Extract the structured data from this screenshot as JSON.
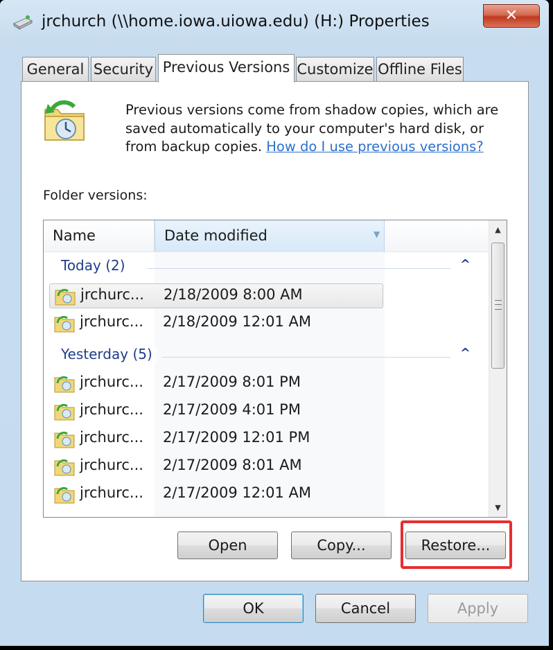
{
  "window": {
    "title": "jrchurch (\\\\home.iowa.uiowa.edu) (H:) Properties",
    "close_label": "✕"
  },
  "tabs": [
    {
      "label": "General",
      "active": false
    },
    {
      "label": "Security",
      "active": false
    },
    {
      "label": "Previous Versions",
      "active": true
    },
    {
      "label": "Customize",
      "active": false
    },
    {
      "label": "Offline Files",
      "active": false
    }
  ],
  "intro": {
    "text": "Previous versions come from shadow copies, which are saved automatically to your computer's hard disk, or from backup copies.",
    "link": "How do I use previous versions?"
  },
  "folder_versions_label": "Folder versions:",
  "list": {
    "columns": [
      "Name",
      "Date modified"
    ],
    "groups": [
      {
        "label": "Today (2)",
        "toggle": "^",
        "rows": [
          {
            "name": "jrchurc...",
            "date": "2/18/2009 8:00 AM",
            "selected": true
          },
          {
            "name": "jrchurc...",
            "date": "2/18/2009 12:01 AM",
            "selected": false
          }
        ]
      },
      {
        "label": "Yesterday (5)",
        "toggle": "^",
        "rows": [
          {
            "name": "jrchurc...",
            "date": "2/17/2009 8:01 PM",
            "selected": false
          },
          {
            "name": "jrchurc...",
            "date": "2/17/2009 4:01 PM",
            "selected": false
          },
          {
            "name": "jrchurc...",
            "date": "2/17/2009 12:01 PM",
            "selected": false
          },
          {
            "name": "jrchurc...",
            "date": "2/17/2009 8:01 AM",
            "selected": false
          },
          {
            "name": "jrchurc...",
            "date": "2/17/2009 12:01 AM",
            "selected": false
          }
        ]
      }
    ]
  },
  "actions": {
    "open": "Open",
    "copy": "Copy...",
    "restore": "Restore..."
  },
  "dialog_buttons": {
    "ok": "OK",
    "cancel": "Cancel",
    "apply": "Apply"
  },
  "icons": {
    "title": "drive-icon",
    "intro": "previous-versions-folder-icon",
    "row": "shadow-copy-folder-icon"
  },
  "colors": {
    "highlight": "#e62e2e",
    "group_text": "#1e3e8a",
    "link": "#2a6fcf"
  }
}
